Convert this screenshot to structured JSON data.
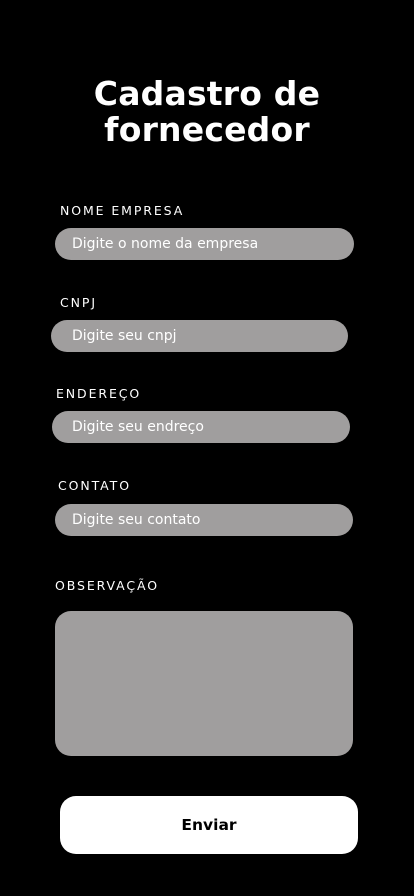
{
  "header": {
    "title_line1": "Cadastro de",
    "title_line2": "fornecedor"
  },
  "form": {
    "nome_empresa": {
      "label": "NOME EMPRESA",
      "placeholder": "Digite o nome da empresa",
      "value": ""
    },
    "cnpj": {
      "label": "CNPJ",
      "placeholder": "Digite seu cnpj",
      "value": ""
    },
    "endereco": {
      "label": "ENDEREÇO",
      "placeholder": "Digite seu endreço",
      "value": ""
    },
    "contato": {
      "label": "CONTATO",
      "placeholder": "Digite seu contato",
      "value": ""
    },
    "observacao": {
      "label": "OBSERVAÇÃO",
      "value": ""
    },
    "submit_label": "Enviar"
  },
  "colors": {
    "background": "#000000",
    "input_fill": "#a09e9e",
    "text": "#ffffff",
    "button_fill": "#ffffff",
    "button_text": "#000000"
  }
}
